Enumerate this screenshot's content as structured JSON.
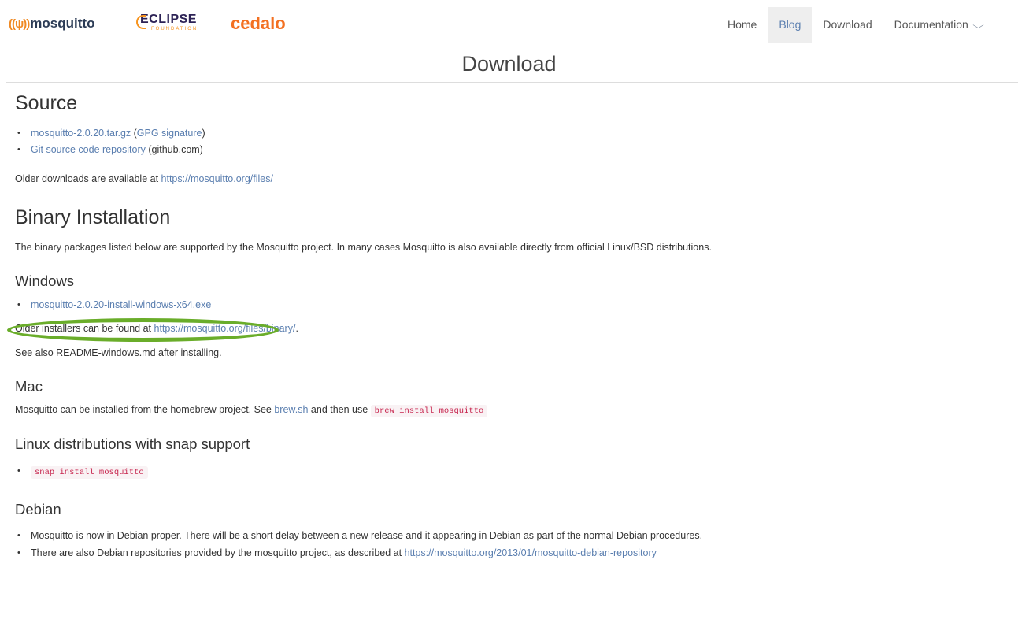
{
  "header": {
    "logo_mosquitto": {
      "waves": "((ψ))",
      "text": "mosquitto"
    },
    "logo_eclipse": {
      "main": "ECLIPSE",
      "sub": "FOUNDATION"
    },
    "logo_cedalo": "cedalo",
    "nav": [
      {
        "label": "Home",
        "active": false
      },
      {
        "label": "Blog",
        "active": true
      },
      {
        "label": "Download",
        "active": false
      },
      {
        "label": "Documentation",
        "active": false
      }
    ],
    "nav_chevron": "⌵"
  },
  "page_title": "Download",
  "source": {
    "heading": "Source",
    "tarball_link": "mosquitto-2.0.20.tar.gz",
    "gpg_open": " (",
    "gpg_link": "GPG signature",
    "gpg_close": ")",
    "git_link": "Git source code repository",
    "git_suffix": " (github.com)",
    "older_prefix": "Older downloads are available at ",
    "older_link": "https://mosquitto.org/files/"
  },
  "binary": {
    "heading": "Binary Installation",
    "intro": "The binary packages listed below are supported by the Mosquitto project. In many cases Mosquitto is also available directly from official Linux/BSD distributions."
  },
  "windows": {
    "heading": "Windows",
    "installer_link": "mosquitto-2.0.20-install-windows-x64.exe",
    "older_prefix": "Older installers can be found at ",
    "older_link": "https://mosquitto.org/files/binary/",
    "older_suffix": ".",
    "readme_note": "See also README-windows.md after installing."
  },
  "mac": {
    "heading": "Mac",
    "text_prefix": "Mosquitto can be installed from the homebrew project. See ",
    "brew_link": "brew.sh",
    "text_mid": " and then use ",
    "command": "brew install mosquitto"
  },
  "snap": {
    "heading": "Linux distributions with snap support",
    "command": "snap install mosquitto"
  },
  "debian": {
    "heading": "Debian",
    "item1": "Mosquitto is now in Debian proper. There will be a short delay between a new release and it appearing in Debian as part of the normal Debian procedures.",
    "item2_prefix": "There are also Debian repositories provided by the mosquitto project, as described at ",
    "item2_link": "https://mosquitto.org/2013/01/mosquitto-debian-repository"
  },
  "colors": {
    "link": "#5b7fb0",
    "highlight": "#6aad2a",
    "code_text": "#c7254e",
    "cedalo": "#f37021"
  }
}
